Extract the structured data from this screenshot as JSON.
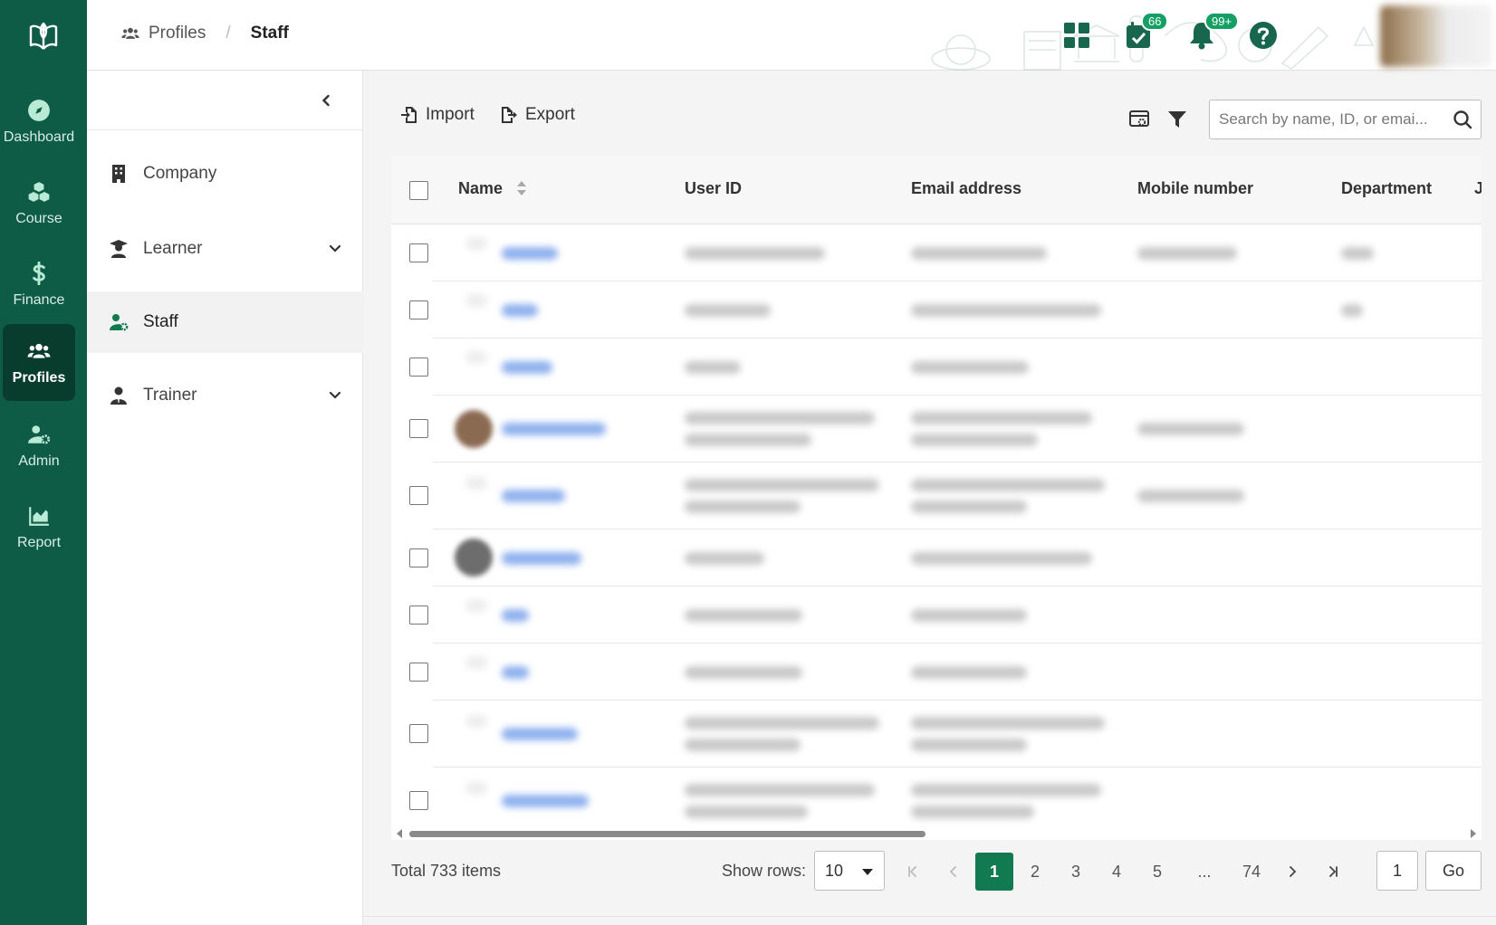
{
  "rail": {
    "items": [
      {
        "label": "Dashboard",
        "icon": "compass-icon"
      },
      {
        "label": "Course",
        "icon": "cubes-icon"
      },
      {
        "label": "Finance",
        "icon": "dollar-icon"
      },
      {
        "label": "Profiles",
        "icon": "users-icon",
        "active": true
      },
      {
        "label": "Admin",
        "icon": "user-gear-icon"
      },
      {
        "label": "Report",
        "icon": "chart-area-icon"
      }
    ]
  },
  "breadcrumb": {
    "root": "Profiles",
    "separator": "/",
    "current": "Staff"
  },
  "header": {
    "tasks_badge": "66",
    "notifications_badge": "99+"
  },
  "subnav": {
    "items": [
      {
        "label": "Company"
      },
      {
        "label": "Learner"
      },
      {
        "label": "Staff"
      },
      {
        "label": "Trainer"
      }
    ]
  },
  "toolbar": {
    "import_label": "Import",
    "export_label": "Export",
    "search_placeholder": "Search by name, ID, or emai..."
  },
  "table": {
    "columns": [
      "Name",
      "User ID",
      "Email address",
      "Mobile number",
      "Department",
      "J"
    ]
  },
  "footer": {
    "total": "Total 733 items",
    "show_rows_label": "Show rows:",
    "rows_value": "10",
    "pages": [
      "1",
      "2",
      "3",
      "4",
      "5",
      "...",
      "74"
    ],
    "current_page": "1",
    "goto_value": "1",
    "go_label": "Go"
  },
  "colors": {
    "brand": "#0f5c46",
    "brand_dark": "#083d2e",
    "accent": "#117a50",
    "badge": "#14a064"
  }
}
